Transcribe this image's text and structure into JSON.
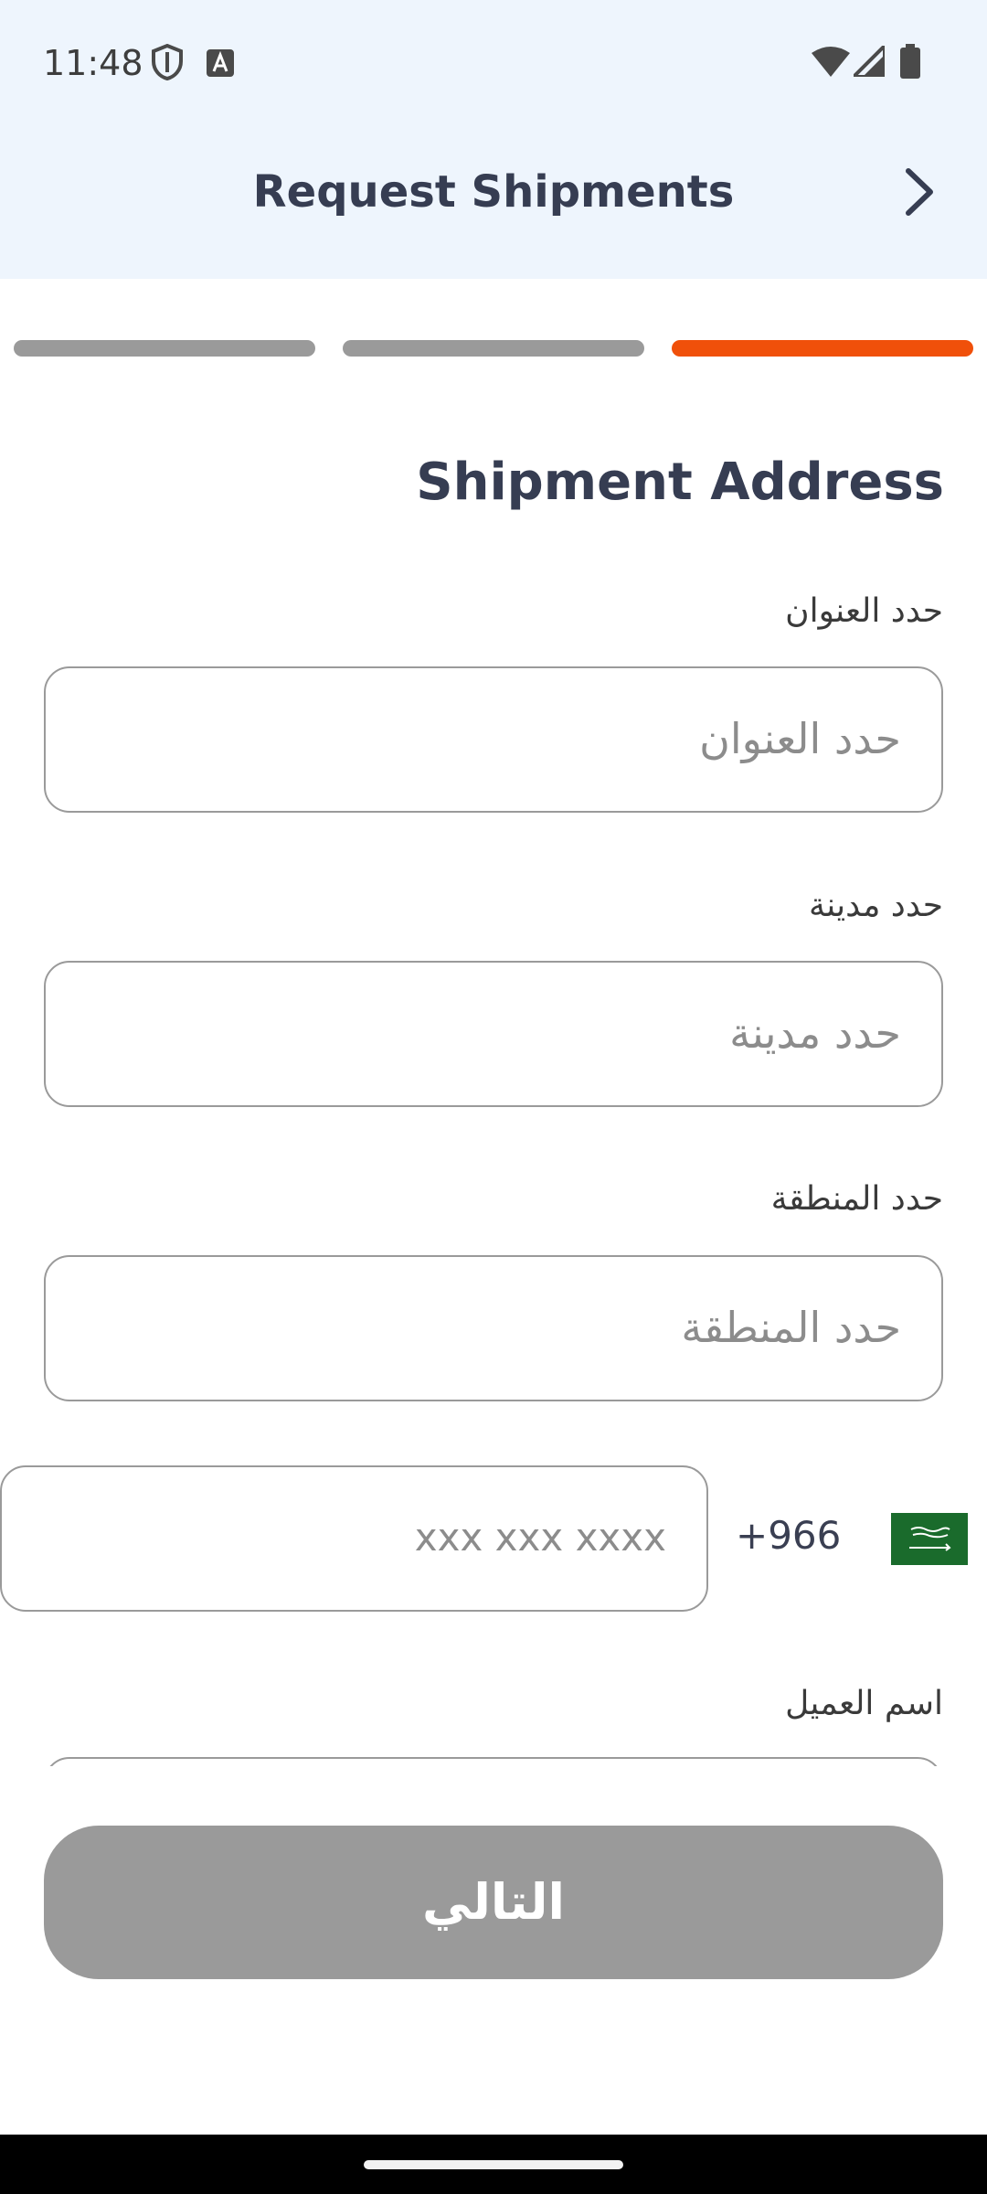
{
  "status_bar": {
    "time": "11:48",
    "icons": [
      "shield-icon",
      "text-a-icon",
      "wifi-icon",
      "signal-icon",
      "battery-icon"
    ]
  },
  "header": {
    "title": "Request Shipments",
    "forward_icon": "chevron-right-icon"
  },
  "steps": {
    "total": 3,
    "current": 3,
    "colors": {
      "inactive": "#9a9a9a",
      "active": "#f0500a"
    }
  },
  "form": {
    "section_title": "Shipment Address",
    "address": {
      "label": "حدد العنوان",
      "placeholder": "حدد العنوان",
      "value": ""
    },
    "city": {
      "label": "حدد مدينة",
      "placeholder": "حدد مدينة",
      "value": ""
    },
    "region": {
      "label": "حدد المنطقة",
      "placeholder": "حدد المنطقة",
      "value": ""
    },
    "phone": {
      "country_code": "+966",
      "placeholder": "xxx xxx xxxx",
      "value": "",
      "flag_icon": "saudi-arabia-flag-icon"
    },
    "customer_name": {
      "label": "اسم العميل"
    }
  },
  "next_button": {
    "label": "التالي",
    "color": "#9a9a9a"
  }
}
